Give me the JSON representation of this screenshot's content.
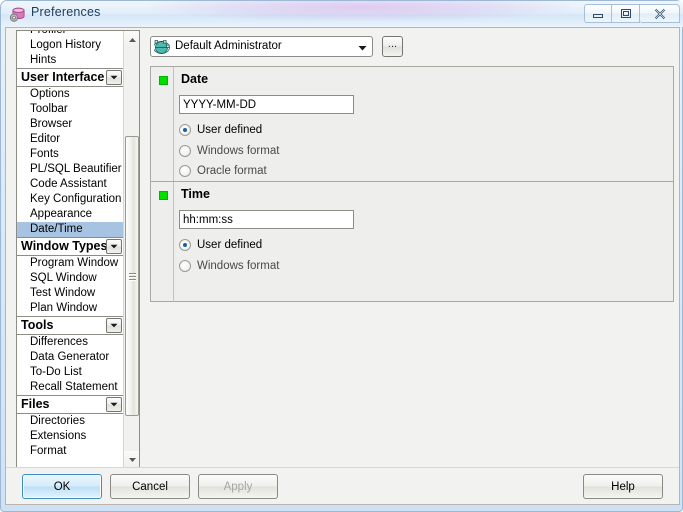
{
  "window": {
    "title": "Preferences",
    "icon": "database-gear-icon",
    "controls": {
      "minimize": "minimize-icon",
      "maximize": "maximize-icon",
      "close": "close-icon"
    }
  },
  "sidebar": {
    "items": [
      {
        "label": "Profiler",
        "type": "leaf",
        "selected": false
      },
      {
        "label": "Logon History",
        "type": "leaf",
        "selected": false
      },
      {
        "label": "Hints",
        "type": "leaf",
        "selected": false
      },
      {
        "label": "User Interface",
        "type": "group",
        "selected": false
      },
      {
        "label": "Options",
        "type": "leaf",
        "selected": false
      },
      {
        "label": "Toolbar",
        "type": "leaf",
        "selected": false
      },
      {
        "label": "Browser",
        "type": "leaf",
        "selected": false
      },
      {
        "label": "Editor",
        "type": "leaf",
        "selected": false
      },
      {
        "label": "Fonts",
        "type": "leaf",
        "selected": false
      },
      {
        "label": "PL/SQL Beautifier",
        "type": "leaf",
        "selected": false
      },
      {
        "label": "Code Assistant",
        "type": "leaf",
        "selected": false
      },
      {
        "label": "Key Configuration",
        "type": "leaf",
        "selected": false
      },
      {
        "label": "Appearance",
        "type": "leaf",
        "selected": false
      },
      {
        "label": "Date/Time",
        "type": "leaf",
        "selected": true
      },
      {
        "label": "Window Types",
        "type": "group",
        "selected": false
      },
      {
        "label": "Program Window",
        "type": "leaf",
        "selected": false
      },
      {
        "label": "SQL Window",
        "type": "leaf",
        "selected": false
      },
      {
        "label": "Test Window",
        "type": "leaf",
        "selected": false
      },
      {
        "label": "Plan Window",
        "type": "leaf",
        "selected": false
      },
      {
        "label": "Tools",
        "type": "group",
        "selected": false
      },
      {
        "label": "Differences",
        "type": "leaf",
        "selected": false
      },
      {
        "label": "Data Generator",
        "type": "leaf",
        "selected": false
      },
      {
        "label": "To-Do List",
        "type": "leaf",
        "selected": false
      },
      {
        "label": "Recall Statement",
        "type": "leaf",
        "selected": false
      },
      {
        "label": "Files",
        "type": "group",
        "selected": false
      },
      {
        "label": "Directories",
        "type": "leaf",
        "selected": false
      },
      {
        "label": "Extensions",
        "type": "leaf",
        "selected": false
      },
      {
        "label": "Format",
        "type": "leaf",
        "selected": false
      }
    ],
    "scrollbar": {
      "up_arrow": "scroll-up-icon",
      "down_arrow": "scroll-down-icon"
    }
  },
  "profile": {
    "icon": "network-globe-icon",
    "value": "Default Administrator",
    "dropdown_arrow": "chevron-down-icon",
    "ellipsis_label": "..."
  },
  "sections": {
    "date": {
      "title": "Date",
      "status": "enabled",
      "status_color": "#00e000",
      "format_value": "YYYY-MM-DD",
      "format_placeholder": "",
      "options": [
        {
          "label": "User defined",
          "checked": true
        },
        {
          "label": "Windows format",
          "checked": false
        },
        {
          "label": "Oracle format",
          "checked": false
        }
      ]
    },
    "time": {
      "title": "Time",
      "status": "enabled",
      "status_color": "#00e000",
      "format_value": "hh:mm:ss",
      "format_placeholder": "",
      "options": [
        {
          "label": "User defined",
          "checked": true
        },
        {
          "label": "Windows format",
          "checked": false
        }
      ]
    }
  },
  "buttons": {
    "ok": "OK",
    "cancel": "Cancel",
    "apply": "Apply",
    "help": "Help"
  }
}
